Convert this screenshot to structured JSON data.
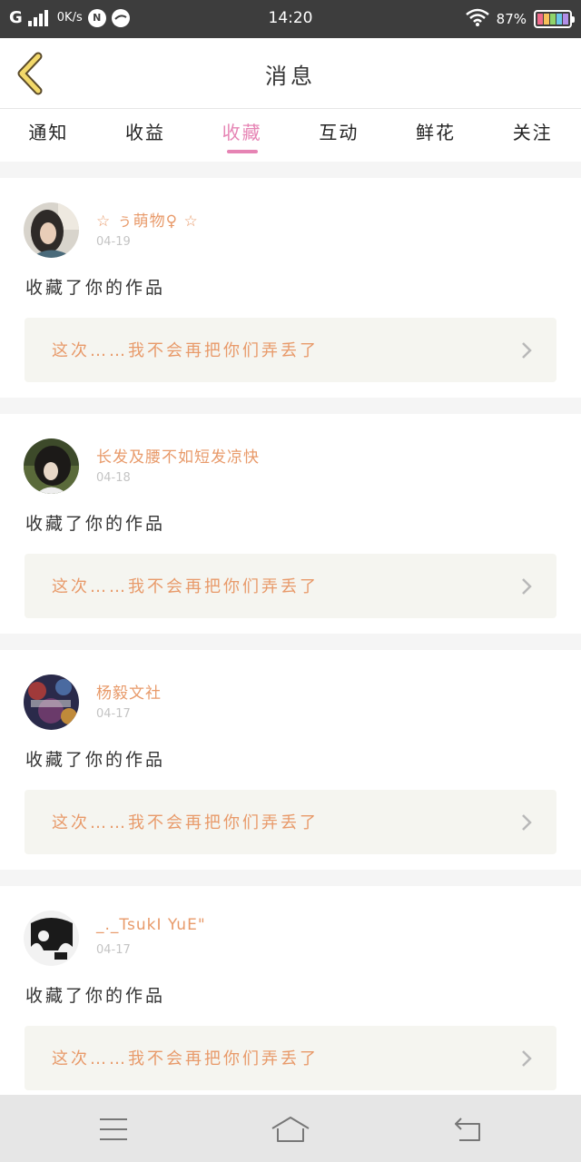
{
  "status_bar": {
    "carrier": "G",
    "speed": "0K/s",
    "badge": "N",
    "time": "14:20",
    "battery_text": "87%",
    "battery_percent": 87
  },
  "header": {
    "title": "消息",
    "back_icon": "chevron-left-icon"
  },
  "tabs": [
    {
      "label": "通知",
      "active": false
    },
    {
      "label": "收益",
      "active": false
    },
    {
      "label": "收藏",
      "active": true
    },
    {
      "label": "互动",
      "active": false
    },
    {
      "label": "鲜花",
      "active": false
    },
    {
      "label": "关注",
      "active": false
    }
  ],
  "colors": {
    "accent_pink": "#e684b4",
    "name_orange": "#e89a6a",
    "status_bar": "#3d3d3d"
  },
  "notifications": [
    {
      "username": "☆ ぅ萌物♀ ☆",
      "date": "04-19",
      "action": "收藏了你的作品",
      "work_title": "这次……我不会再把你们弄丢了"
    },
    {
      "username": "长发及腰不如短发凉快",
      "date": "04-18",
      "action": "收藏了你的作品",
      "work_title": "这次……我不会再把你们弄丢了"
    },
    {
      "username": "杨毅文社",
      "date": "04-17",
      "action": "收藏了你的作品",
      "work_title": "这次……我不会再把你们弄丢了"
    },
    {
      "username": "_._TsukI YuE\"",
      "date": "04-17",
      "action": "收藏了你的作品",
      "work_title": "这次……我不会再把你们弄丢了"
    }
  ],
  "navbar": {
    "menu_icon": "menu-icon",
    "home_icon": "home-icon",
    "back_icon": "back-arrow-icon"
  }
}
